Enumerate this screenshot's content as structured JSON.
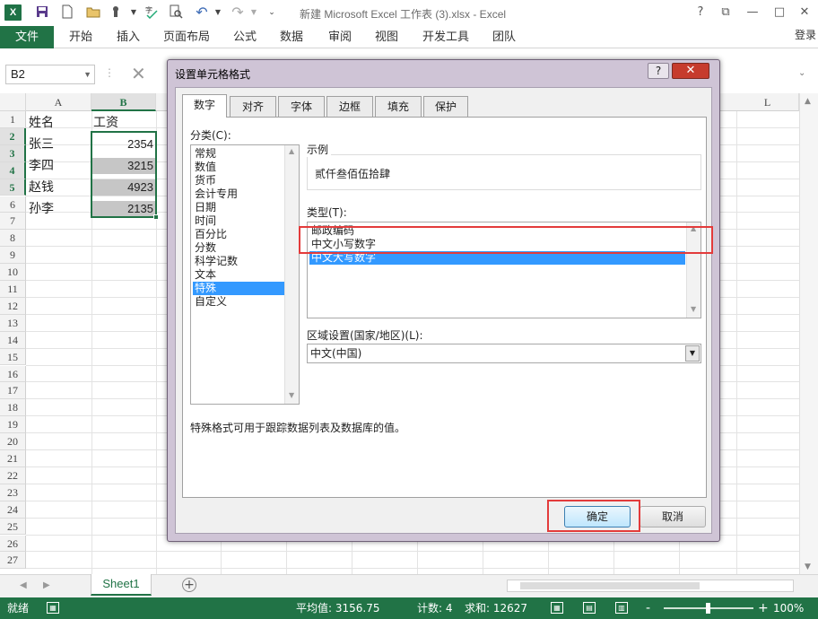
{
  "app": {
    "logo": "X",
    "window_title": "新建 Microsoft Excel 工作表 (3).xlsx - Excel",
    "controls": {
      "help": "?",
      "restore": "⧉",
      "minimize": "—",
      "maximize": "□",
      "close": "✕"
    }
  },
  "quick_access": [
    "save-icon",
    "new-file-icon",
    "open-folder-icon",
    "touch-mode-icon",
    "spelling-icon",
    "print-preview-icon",
    "undo-icon",
    "redo-icon",
    "customize-icon"
  ],
  "ribbon": {
    "file_tab": "文件",
    "tabs": [
      "开始",
      "插入",
      "页面布局",
      "公式",
      "数据",
      "审阅",
      "视图",
      "开发工具",
      "团队"
    ],
    "login": "登录"
  },
  "formula_bar": {
    "name_box": "B2",
    "cancel_glyph": "✕"
  },
  "grid": {
    "columns": [
      "A",
      "B",
      "L"
    ],
    "rows": [
      "1",
      "2",
      "3",
      "4",
      "5",
      "6",
      "7",
      "8",
      "9",
      "10",
      "11",
      "12",
      "13",
      "14",
      "15",
      "16",
      "17",
      "18",
      "19",
      "20",
      "21",
      "22",
      "23",
      "24",
      "25",
      "26",
      "27"
    ],
    "header_row": {
      "a": "姓名",
      "b": "工资"
    },
    "data": [
      {
        "name": "张三",
        "salary": "2354"
      },
      {
        "name": "李四",
        "salary": "3215"
      },
      {
        "name": "赵钱",
        "salary": "4923"
      },
      {
        "name": "孙李",
        "salary": "2135"
      }
    ]
  },
  "sheet_tabs": {
    "active": "Sheet1",
    "add": "+"
  },
  "status_bar": {
    "mode": "就绪",
    "average": "平均值: 3156.75",
    "count": "计数: 4",
    "sum": "求和: 12627",
    "zoom": "100%",
    "zoom_minus": "-",
    "zoom_plus": "+"
  },
  "dialog": {
    "title": "设置单元格格式",
    "help": "?",
    "close": "✕",
    "tabs": [
      "数字",
      "对齐",
      "字体",
      "边框",
      "填充",
      "保护"
    ],
    "active_tab": "数字",
    "category_label": "分类(C):",
    "categories": [
      "常规",
      "数值",
      "货币",
      "会计专用",
      "日期",
      "时间",
      "百分比",
      "分数",
      "科学记数",
      "文本",
      "特殊",
      "自定义"
    ],
    "selected_category": "特殊",
    "sample_label": "示例",
    "sample_value": "贰仟叁佰伍拾肆",
    "type_label": "类型(T):",
    "types": [
      "邮政编码",
      "中文小写数字",
      "中文大写数字"
    ],
    "selected_type": "中文大写数字",
    "locale_label": "区域设置(国家/地区)(L):",
    "locale_value": "中文(中国)",
    "description": "特殊格式可用于跟踪数据列表及数据库的值。",
    "ok": "确定",
    "cancel": "取消"
  },
  "colors": {
    "excel_green": "#217346",
    "selection_blue": "#3399ff",
    "highlight_red": "#e33b3b",
    "dialog_frame": "#cfc4d6"
  }
}
